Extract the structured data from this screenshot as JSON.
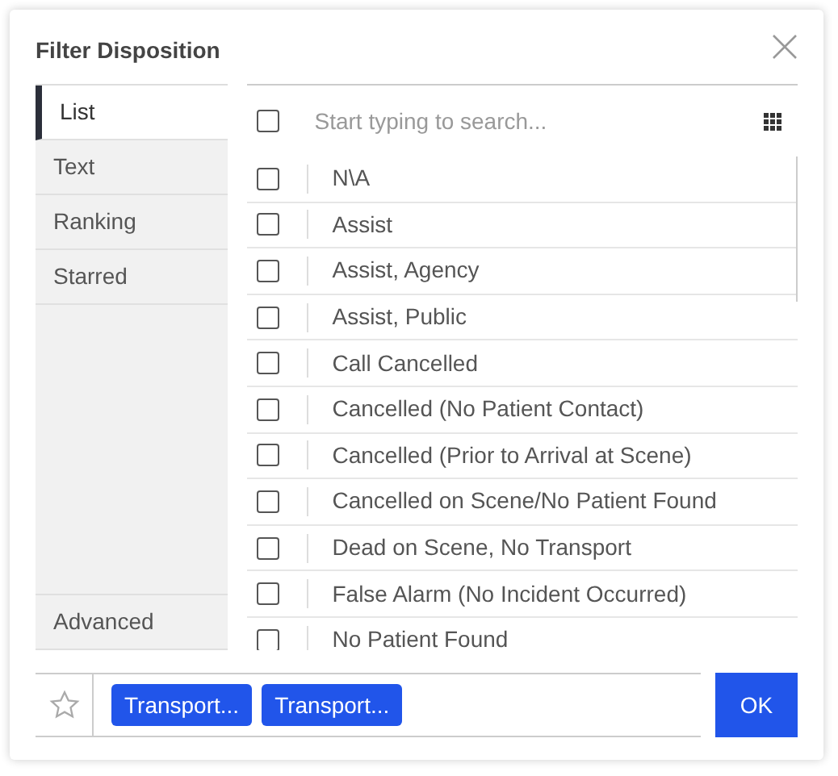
{
  "dialog": {
    "title": "Filter Disposition"
  },
  "sidebar": {
    "tabs": [
      {
        "label": "List",
        "selected": true
      },
      {
        "label": "Text",
        "selected": false
      },
      {
        "label": "Ranking",
        "selected": false
      },
      {
        "label": "Starred",
        "selected": false
      }
    ],
    "bottom_tab": {
      "label": "Advanced",
      "selected": false
    }
  },
  "search": {
    "placeholder": "Start typing to search...",
    "select_all_checked": false
  },
  "items": [
    {
      "label": "N\\A",
      "checked": false
    },
    {
      "label": "Assist",
      "checked": false
    },
    {
      "label": "Assist, Agency",
      "checked": false
    },
    {
      "label": "Assist, Public",
      "checked": false
    },
    {
      "label": "Call Cancelled",
      "checked": false
    },
    {
      "label": "Cancelled (No Patient Contact)",
      "checked": false
    },
    {
      "label": "Cancelled (Prior to Arrival at Scene)",
      "checked": false
    },
    {
      "label": "Cancelled on Scene/No Patient Found",
      "checked": false
    },
    {
      "label": "Dead on Scene, No Transport",
      "checked": false
    },
    {
      "label": "False Alarm (No Incident Occurred)",
      "checked": false
    },
    {
      "label": "No Patient Found",
      "checked": false
    }
  ],
  "footer": {
    "starred": false,
    "chips": [
      "Transport...",
      "Transport..."
    ],
    "ok_button": "OK"
  }
}
